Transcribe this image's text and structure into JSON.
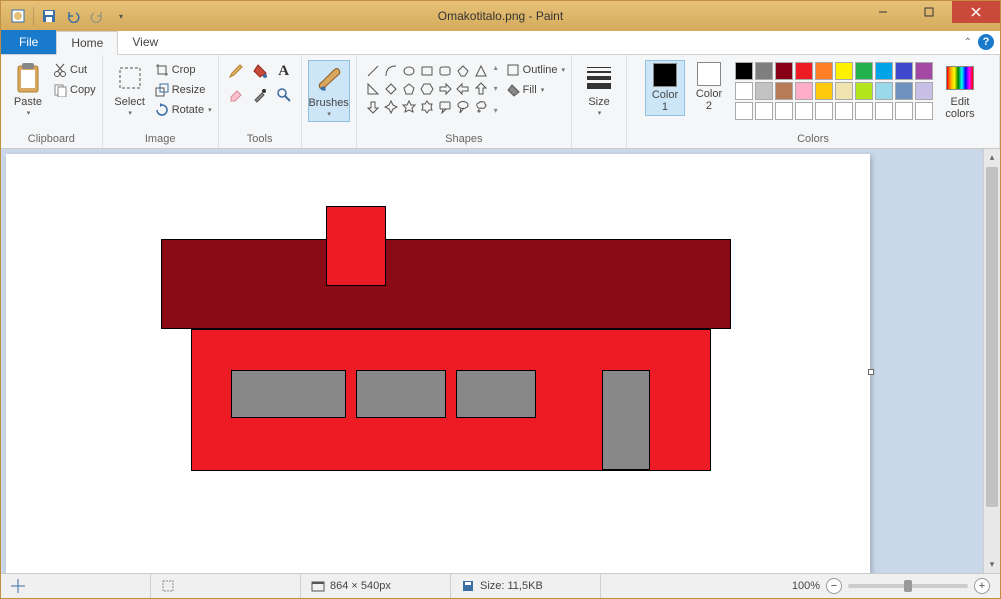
{
  "title": "Omakotitalo.png - Paint",
  "tabs": {
    "file": "File",
    "home": "Home",
    "view": "View"
  },
  "clipboard": {
    "paste": "Paste",
    "cut": "Cut",
    "copy": "Copy",
    "label": "Clipboard"
  },
  "image": {
    "select": "Select",
    "crop": "Crop",
    "resize": "Resize",
    "rotate": "Rotate",
    "label": "Image"
  },
  "tools": {
    "label": "Tools"
  },
  "brushes": {
    "label": "Brushes"
  },
  "shapes": {
    "outline": "Outline",
    "fill": "Fill",
    "label": "Shapes"
  },
  "size": {
    "label": "Size"
  },
  "colors": {
    "c1": "Color\n1",
    "c2": "Color\n2",
    "edit": "Edit\ncolors",
    "label": "Colors",
    "color1": "#000000",
    "color2": "#ffffff",
    "palette_row1": [
      "#000000",
      "#7f7f7f",
      "#880015",
      "#ed1c24",
      "#ff7f27",
      "#fff200",
      "#22b14c",
      "#00a2e8",
      "#3f48cc",
      "#a349a4"
    ],
    "palette_row2": [
      "#ffffff",
      "#c3c3c3",
      "#b97a57",
      "#ffaec9",
      "#ffc90e",
      "#efe4b0",
      "#b5e61d",
      "#99d9ea",
      "#7092be",
      "#c8bfe7"
    ],
    "palette_row3": [
      "#ffffff",
      "#ffffff",
      "#ffffff",
      "#ffffff",
      "#ffffff",
      "#ffffff",
      "#ffffff",
      "#ffffff",
      "#ffffff",
      "#ffffff"
    ]
  },
  "status": {
    "dimensions": "864 × 540px",
    "size": "Size: 11,5KB",
    "zoom": "100%"
  }
}
